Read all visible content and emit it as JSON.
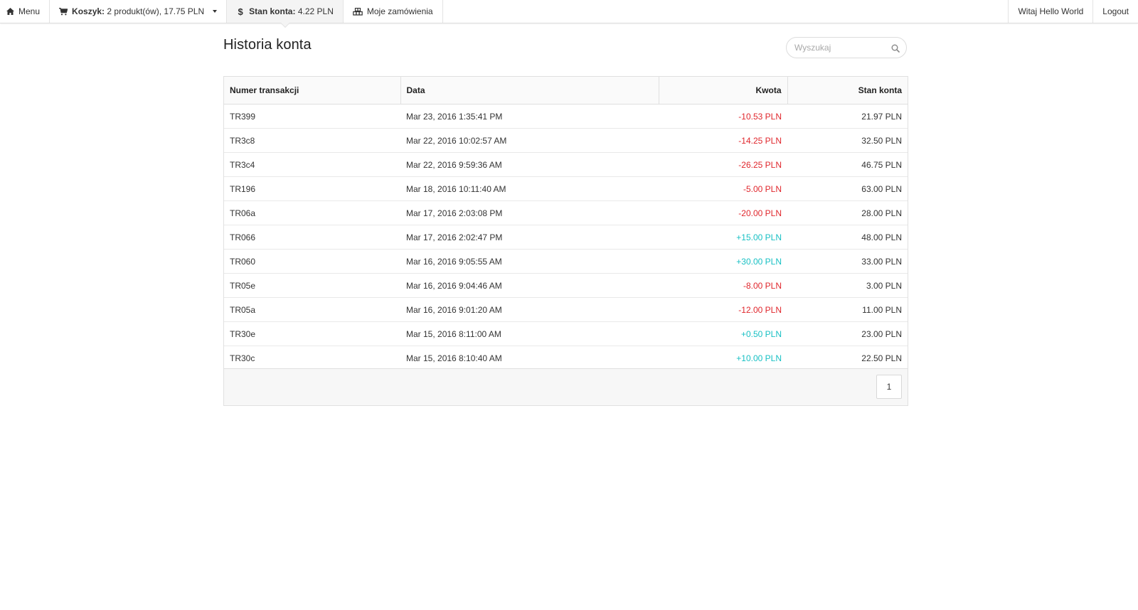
{
  "nav": {
    "menu_label": "Menu",
    "cart_strong": "Koszyk:",
    "cart_text": "2 produkt(ów), 17.75 PLN",
    "balance_strong": "Stan konta:",
    "balance_text": "4.22 PLN",
    "orders_label": "Moje zamówienia",
    "welcome_label": "Witaj Hello World",
    "logout_label": "Logout"
  },
  "page": {
    "title": "Historia konta",
    "search_placeholder": "Wyszukaj"
  },
  "table": {
    "headers": [
      "Numer transakcji",
      "Data",
      "Kwota",
      "Stan konta"
    ],
    "rows": [
      {
        "id": "TR399",
        "date": "Mar 23, 2016 1:35:41 PM",
        "amount": "-10.53 PLN",
        "sign": "neg",
        "balance": "21.97 PLN"
      },
      {
        "id": "TR3c8",
        "date": "Mar 22, 2016 10:02:57 AM",
        "amount": "-14.25 PLN",
        "sign": "neg",
        "balance": "32.50 PLN"
      },
      {
        "id": "TR3c4",
        "date": "Mar 22, 2016 9:59:36 AM",
        "amount": "-26.25 PLN",
        "sign": "neg",
        "balance": "46.75 PLN"
      },
      {
        "id": "TR196",
        "date": "Mar 18, 2016 10:11:40 AM",
        "amount": "-5.00 PLN",
        "sign": "neg",
        "balance": "63.00 PLN"
      },
      {
        "id": "TR06a",
        "date": "Mar 17, 2016 2:03:08 PM",
        "amount": "-20.00 PLN",
        "sign": "neg",
        "balance": "28.00 PLN"
      },
      {
        "id": "TR066",
        "date": "Mar 17, 2016 2:02:47 PM",
        "amount": "+15.00 PLN",
        "sign": "pos",
        "balance": "48.00 PLN"
      },
      {
        "id": "TR060",
        "date": "Mar 16, 2016 9:05:55 AM",
        "amount": "+30.00 PLN",
        "sign": "pos",
        "balance": "33.00 PLN"
      },
      {
        "id": "TR05e",
        "date": "Mar 16, 2016 9:04:46 AM",
        "amount": "-8.00 PLN",
        "sign": "neg",
        "balance": "3.00 PLN"
      },
      {
        "id": "TR05a",
        "date": "Mar 16, 2016 9:01:20 AM",
        "amount": "-12.00 PLN",
        "sign": "neg",
        "balance": "11.00 PLN"
      },
      {
        "id": "TR30e",
        "date": "Mar 15, 2016 8:11:00 AM",
        "amount": "+0.50 PLN",
        "sign": "pos",
        "balance": "23.00 PLN"
      },
      {
        "id": "TR30c",
        "date": "Mar 15, 2016 8:10:40 AM",
        "amount": "+10.00 PLN",
        "sign": "pos",
        "balance": "22.50 PLN"
      }
    ]
  },
  "pagination": {
    "current_page": "1"
  },
  "colors": {
    "negative": "#e0262c",
    "positive": "#18c0c4"
  },
  "icons": {
    "menu": "home-icon",
    "cart": "cart-icon",
    "balance": "dollar-icon",
    "orders": "cubes-icon",
    "search": "search-icon"
  }
}
